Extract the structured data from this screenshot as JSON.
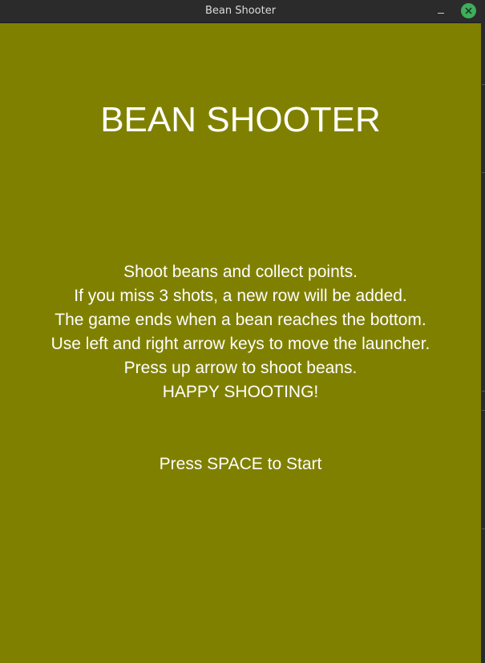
{
  "window": {
    "title": "Bean Shooter",
    "minimize_icon": "minimize-icon",
    "close_icon": "close-icon",
    "close_color": "#3fae5b"
  },
  "game": {
    "background_color": "#808000",
    "text_color": "#ffffff",
    "title": "BEAN SHOOTER",
    "instructions": [
      "Shoot beans and collect points.",
      "If you miss 3 shots, a new row will be added.",
      "The game ends when a bean reaches the bottom.",
      "Use left and right arrow keys to move the launcher.",
      "Press up arrow to shoot beans.",
      "HAPPY SHOOTING!"
    ],
    "start_prompt": "Press SPACE to Start"
  }
}
